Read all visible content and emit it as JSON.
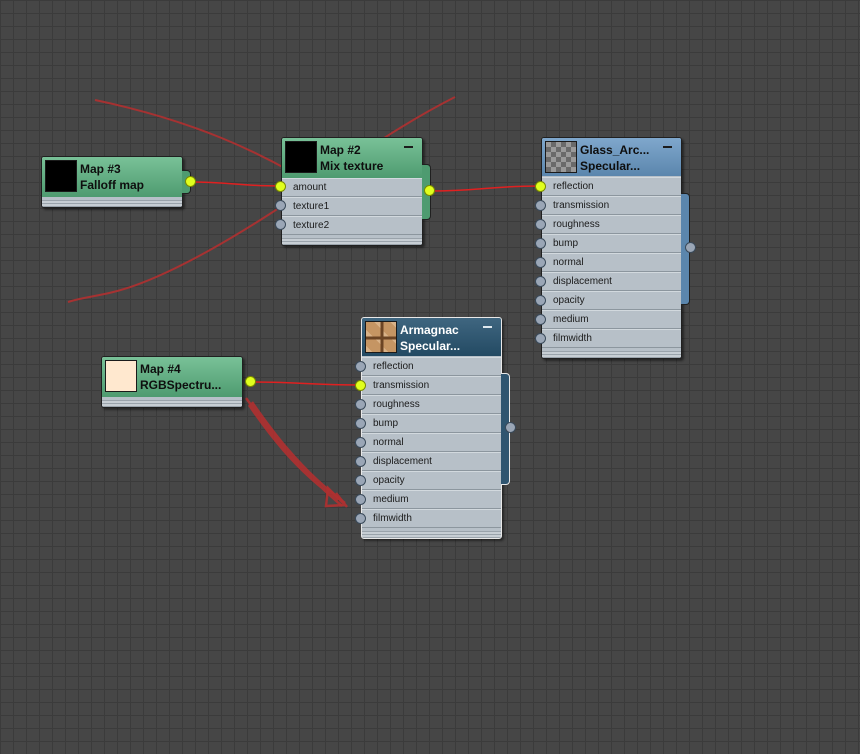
{
  "nodes": {
    "map3": {
      "title": "Map #3",
      "subtitle": "Falloff map"
    },
    "map2": {
      "title": "Map #2",
      "subtitle": "Mix texture",
      "slots": [
        "amount",
        "texture1",
        "texture2"
      ]
    },
    "glass": {
      "title": "Glass_Arc...",
      "subtitle": "Specular...",
      "slots": [
        "reflection",
        "transmission",
        "roughness",
        "bump",
        "normal",
        "displacement",
        "opacity",
        "medium",
        "filmwidth"
      ]
    },
    "map4": {
      "title": "Map #4",
      "subtitle": "RGBSpectru..."
    },
    "armagnac": {
      "title": "Armagnac",
      "subtitle": "Specular...",
      "slots": [
        "reflection",
        "transmission",
        "roughness",
        "bump",
        "normal",
        "displacement",
        "opacity",
        "medium",
        "filmwidth"
      ]
    }
  },
  "colors": {
    "canvas": "#464646",
    "wire": "#e02020",
    "annotation": "#b03030",
    "active_socket": "#e0ff1e",
    "map_header": "#5fae82",
    "material_header": "#6b97c0",
    "selected_header": "#2e5670"
  }
}
